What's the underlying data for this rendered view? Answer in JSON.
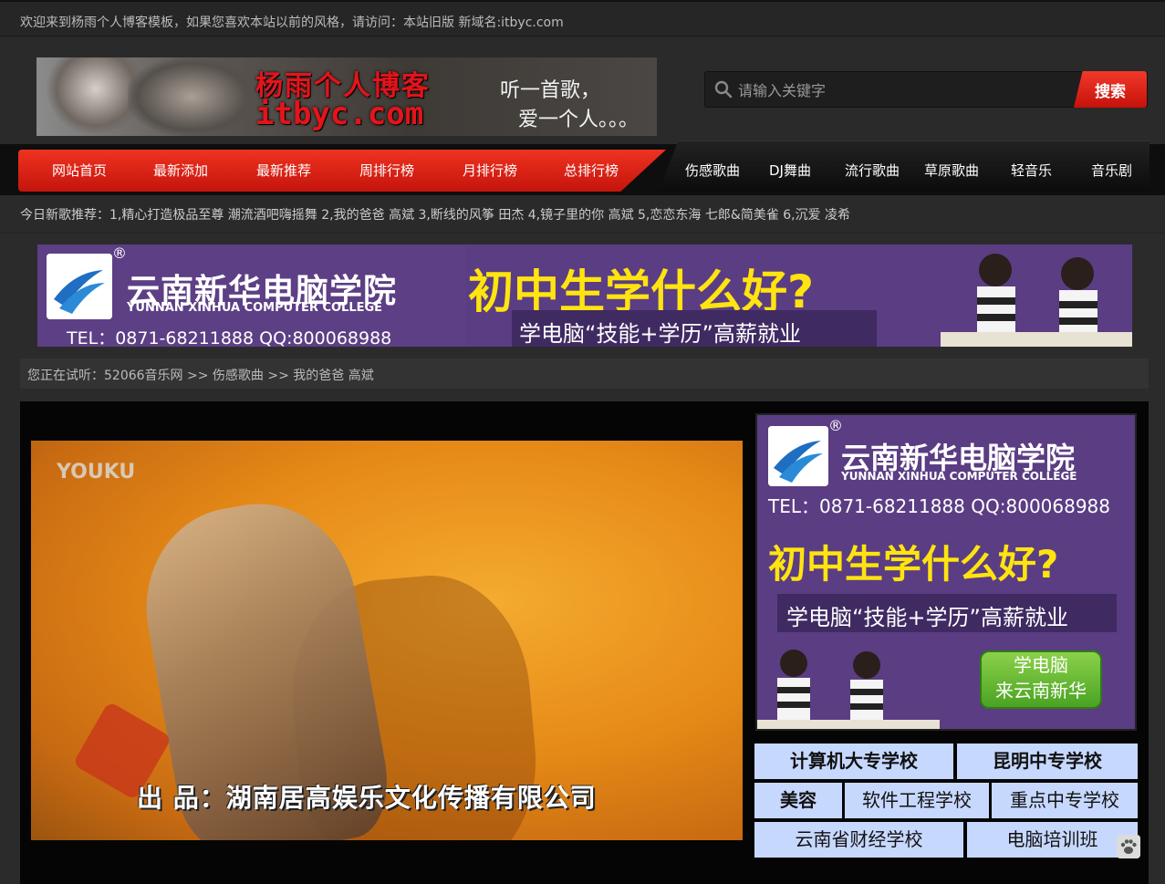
{
  "topbar": {
    "message": "欢迎来到杨雨个人博客模板，如果您喜欢本站以前的风格，请访问：本站旧版 新域名:itbyc.com"
  },
  "logo": {
    "title_cn": "杨雨个人博客",
    "title_en": "itbyc.com",
    "slogan_line1": "听一首歌，",
    "slogan_line2": "爱一个人。。。"
  },
  "search": {
    "placeholder": "请输入关键字",
    "button_label": "搜索",
    "icon": "search-icon"
  },
  "nav": {
    "primary": [
      "网站首页",
      "最新添加",
      "最新推荐",
      "周排行榜",
      "月排行榜",
      "总排行榜"
    ],
    "secondary": [
      "伤感歌曲",
      "DJ舞曲",
      "流行歌曲",
      "草原歌曲",
      "轻音乐",
      "音乐剧"
    ]
  },
  "ticker": {
    "text": "今日新歌推荐：1,精心打造极品至尊 潮流酒吧嗨摇舞 2,我的爸爸 高斌 3,断线的风筝 田杰 4,镜子里的你 高斌 5,恋恋东海 七郎&简美雀 6,沉爱 凌希"
  },
  "banner": {
    "registered": "®",
    "school_cn": "云南新华电脑学院",
    "school_en": "YUNNAN XINHUA COMPUTER COLLEGE",
    "tel": "TEL：0871-68211888   QQ:800068988",
    "headline": "初中生学什么好?",
    "subline": "学电脑“技能+学历”高薪就业"
  },
  "breadcrumb": {
    "text": "您正在试听：52066音乐网 >> 伤感歌曲 >> 我的爸爸 高斌"
  },
  "video": {
    "watermark": "YOUKU",
    "caption": "出  品：湖南居高娱乐文化传播有限公司"
  },
  "side_ad": {
    "registered": "®",
    "school_cn": "云南新华电脑学院",
    "school_en": "YUNNAN XINHUA COMPUTER COLLEGE",
    "tel": "TEL：0871-68211888   QQ:800068988",
    "headline": "初中生学什么好?",
    "subline": "学电脑“技能+学历”高薪就业",
    "cta_line1": "学电脑",
    "cta_line2": "来云南新华"
  },
  "links": {
    "row1": [
      "计算机大专学校",
      "昆明中专学校"
    ],
    "row2": [
      "美容",
      "软件工程学校",
      "重点中专学校"
    ],
    "row3": [
      "云南省财经学校",
      "电脑培训班"
    ]
  },
  "colors": {
    "nav_red": "#e3141b",
    "headline_yellow": "#ffe410",
    "ad_purple": "#5b3d83",
    "link_bg": "#c7d8ff"
  }
}
